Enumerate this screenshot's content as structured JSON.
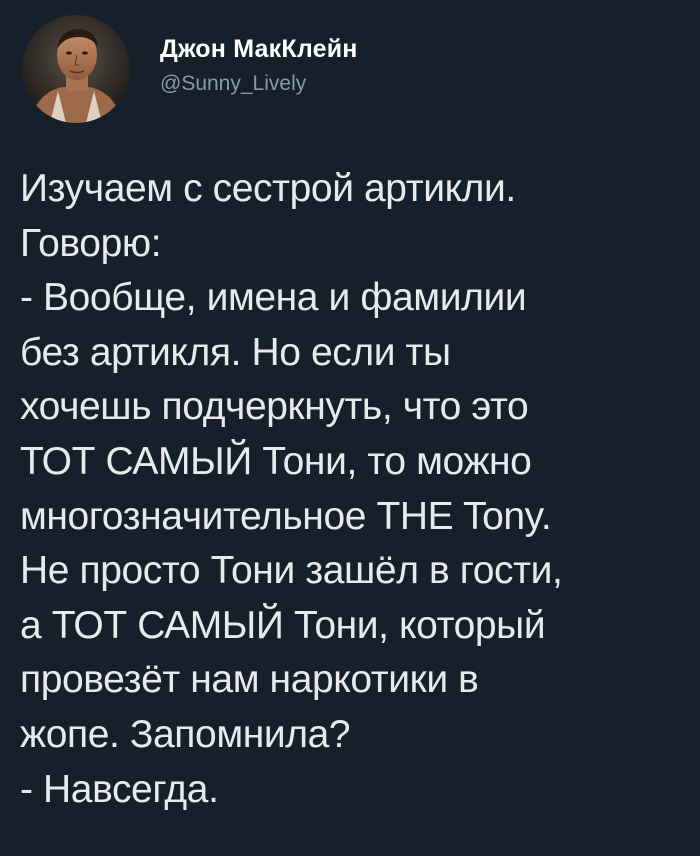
{
  "author": {
    "display_name": "Джон МакКлейн",
    "handle": "@Sunny_Lively"
  },
  "tweet": {
    "lines": [
      "Изучаем с сестрой артикли.",
      "Говорю:",
      "- Вообще, имена и фамилии",
      "без артикля. Но если ты",
      "хочешь подчеркнуть, что это",
      "ТОТ САМЫЙ Тони, то можно",
      "многозначительное THE Tony.",
      "Не просто Тони зашёл в гости,",
      "а ТОТ САМЫЙ Тони, который",
      "провезёт нам наркотики в",
      "жопе. Запомнила?",
      "- Навсегда."
    ]
  },
  "colors": {
    "background": "#15202b",
    "text": "#e7e9ea",
    "name": "#ffffff",
    "handle": "#8b98a5"
  }
}
